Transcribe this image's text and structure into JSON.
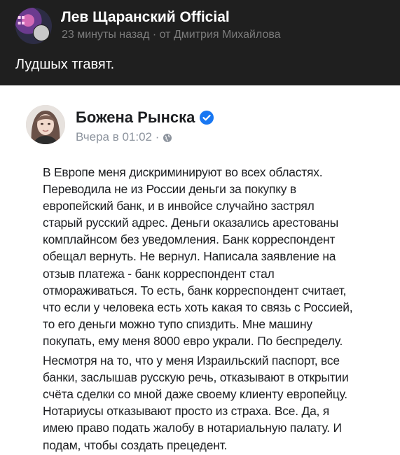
{
  "channel": {
    "name": "Лев Щаранский Official",
    "meta": "23 минуты назад · от Дмитрия Михайлова",
    "message": "Лудшых тгавят.",
    "avatar_colors": [
      "#d46ab5",
      "#6b3b8f",
      "#2c2c44"
    ]
  },
  "post": {
    "author": "Божена Рынска",
    "time": "Вчера в 01:02 ·",
    "verified_icon": "verified-check-icon",
    "privacy_icon": "globe-icon",
    "paragraphs": [
      "В Европе меня дискриминируют во всех областях.\nПереводила не из России деньги за покупку в\nевропейский банк, и в инвойсе случайно застрял\nстарый русский адрес. Деньги оказались арестованы\nкомплайнсом без уведомления. Банк корреспондент\nобещал вернуть. Не вернул. Написала заявление на\nотзыв платежа - банк корреспондент стал\nотмораживаться. То есть, банк корреспондент считает,\nчто если у человека есть хоть какая то связь с Россией,\nто его деньги можно тупо спиздить. Мне машину\nпокупать, ему меня 8000 евро украли. По беспределу.",
      "Несмотря на то, что у меня Израильский паспорт, все\nбанки, заслышав русскую речь, отказывают в открытии\nсчёта сделки со мной даже своему клиенту европейцу.\nНотариусы отказывают просто из страха. Все. Да, я\nимею право подать жалобу в нотариальную палату. И\nподам, чтобы создать прецедент."
    ],
    "colors": {
      "verified": "#1877f2",
      "text": "#1c1e21",
      "meta": "#8d949e"
    }
  }
}
